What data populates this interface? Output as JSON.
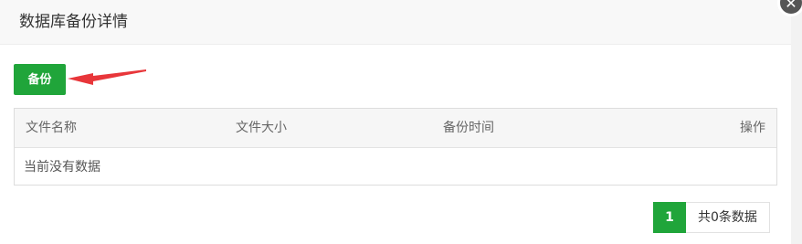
{
  "dialog": {
    "title": "数据库备份详情",
    "close_icon": "close-icon"
  },
  "toolbar": {
    "backup_label": "备份",
    "annotation": "red-arrow-icon",
    "accent_color": "#20a53a"
  },
  "table": {
    "columns": [
      "文件名称",
      "文件大小",
      "备份时间",
      "操作"
    ],
    "empty_text": "当前没有数据"
  },
  "pagination": {
    "current_page": "1",
    "total_text": "共0条数据"
  }
}
